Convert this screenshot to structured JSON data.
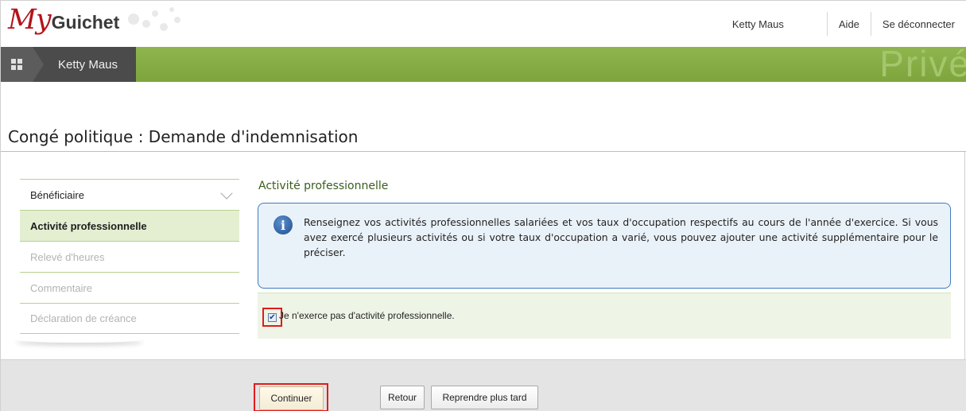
{
  "header": {
    "logo_my": "My",
    "logo_guichet": "Guichet",
    "user_name": "Ketty Maus",
    "help_label": "Aide",
    "logout_label": "Se déconnecter"
  },
  "navbar": {
    "breadcrumb_user": "Ketty Maus",
    "space_label": "Privé"
  },
  "page": {
    "title": "Congé politique : Demande d'indemnisation"
  },
  "sidebar": {
    "items": [
      {
        "label": "Bénéficiaire",
        "state": "completed"
      },
      {
        "label": "Activité professionnelle",
        "state": "active"
      },
      {
        "label": "Relevé d'heures",
        "state": "disabled"
      },
      {
        "label": "Commentaire",
        "state": "disabled"
      },
      {
        "label": "Déclaration de créance",
        "state": "disabled"
      }
    ]
  },
  "main": {
    "section_title": "Activité professionnelle",
    "info_text": "Renseignez vos activités professionnelles salariées et vos taux d'occupation respectifs au cours de l'année d'exercice. Si vous avez exercé plusieurs activités ou si votre taux d'occupation a varié, vous pouvez ajouter une activité supplémentaire pour le préciser.",
    "no_activity_checkbox": {
      "label": "Je n'exerce pas d'activité professionnelle.",
      "checked": true
    }
  },
  "footer": {
    "continue_label": "Continuer",
    "back_label": "Retour",
    "later_label": "Reprendre plus tard"
  },
  "colors": {
    "brand_red": "#b5121b",
    "green_bar": "#86ad45",
    "active_nav_bg": "#e4efd1",
    "info_border": "#3f7bc1",
    "highlight_red": "#e21b1b"
  }
}
